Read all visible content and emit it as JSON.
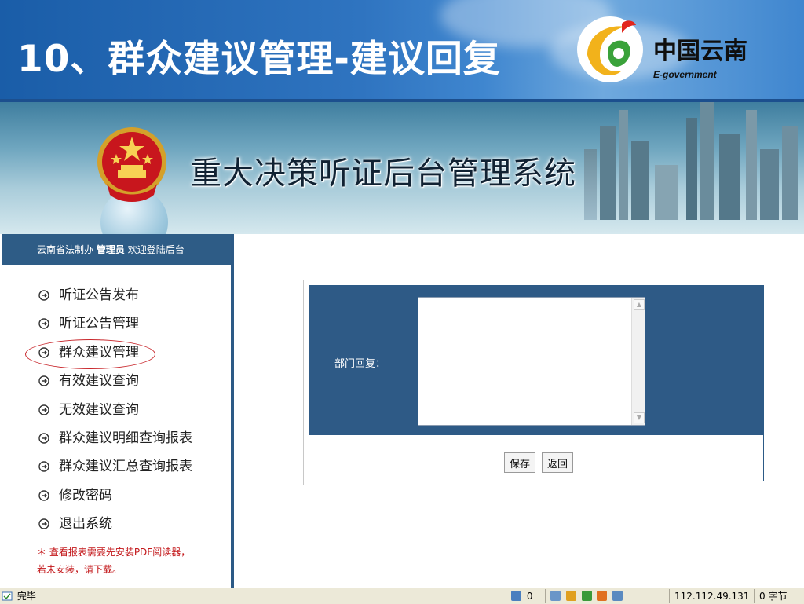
{
  "slide": {
    "title": "10、群众建议管理-建议回复",
    "logo_name": "中国云南",
    "logo_sub": "E-government"
  },
  "banner": {
    "system_title": "重大决策听证后台管理系统"
  },
  "sidebar": {
    "org": "云南省法制办",
    "role": "管理员",
    "welcome": "欢迎登陆后台",
    "items": [
      {
        "label": "听证公告发布",
        "icon": "pointing-hand-icon"
      },
      {
        "label": "听证公告管理",
        "icon": "pointing-hand-icon"
      },
      {
        "label": "群众建议管理",
        "icon": "pointing-hand-icon"
      },
      {
        "label": "有效建议查询",
        "icon": "pointing-hand-icon"
      },
      {
        "label": "无效建议查询",
        "icon": "pointing-hand-icon"
      },
      {
        "label": "群众建议明细查询报表",
        "icon": "pointing-hand-icon"
      },
      {
        "label": "群众建议汇总查询报表",
        "icon": "pointing-hand-icon"
      },
      {
        "label": "修改密码",
        "icon": "pointing-hand-icon"
      },
      {
        "label": "退出系统",
        "icon": "pointing-hand-icon"
      }
    ],
    "note_line1": "＊ 查看报表需要先安装PDF阅读器，",
    "note_line2": "若未安装，请下载。"
  },
  "form": {
    "reply_label": "部门回复：",
    "reply_value": "",
    "save_label": "保存",
    "back_label": "返回"
  },
  "statusbar": {
    "status_text": "完毕",
    "counter": "0",
    "ip": "112.112.49.131",
    "bytes": "0 字节"
  },
  "colors": {
    "header_blue": "#1a5da8",
    "panel_blue": "#2e5a86",
    "highlight_red": "#c8262b",
    "note_red": "#c3181b"
  }
}
